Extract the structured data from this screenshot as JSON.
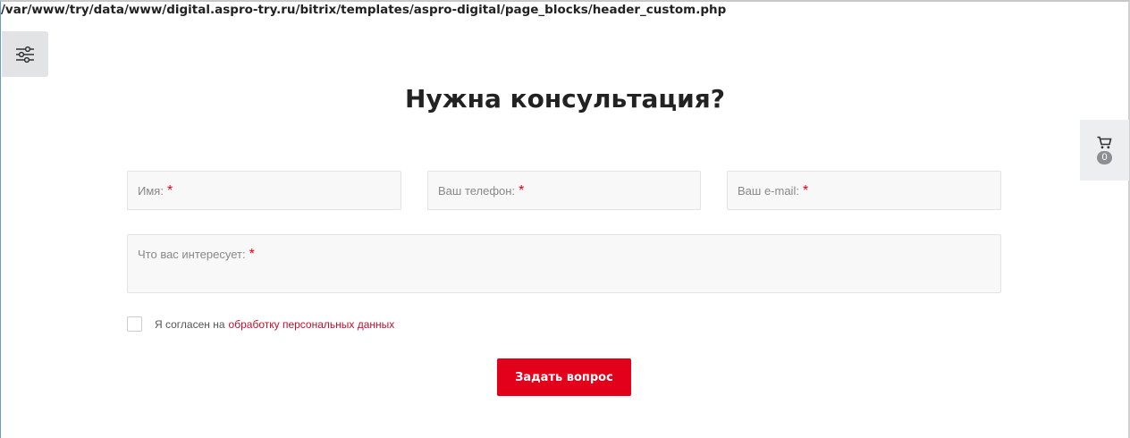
{
  "path_text": "/var/www/try/data/www/digital.aspro-try.ru/bitrix/templates/aspro-digital/page_blocks/header_custom.php",
  "filter_button": {
    "icon": "sliders-icon"
  },
  "cart": {
    "icon": "cart-icon",
    "count": "0"
  },
  "form": {
    "title": "Нужна консультация?",
    "required_mark": "*",
    "fields": {
      "name": "Имя:",
      "phone": "Ваш телефон:",
      "email": "Ваш e-mail:",
      "interest": "Что вас интересует:"
    },
    "consent": {
      "text": "Я согласен на",
      "link": "обработку персональных данных"
    },
    "submit_label": "Задать вопрос"
  },
  "colors": {
    "accent": "#e2001a",
    "link": "#c0102e",
    "field_bg": "#f8f8f8",
    "widget_bg": "#e2e3e5"
  }
}
